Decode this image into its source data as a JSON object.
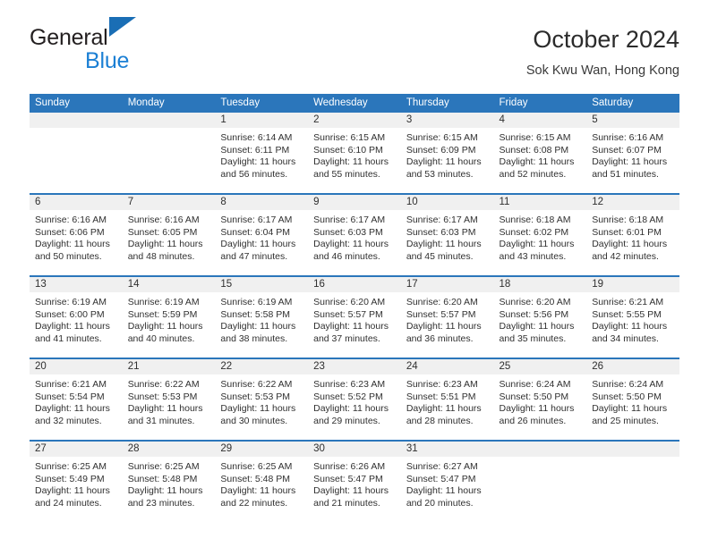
{
  "brand": {
    "name_top": "General",
    "name_bottom": "Blue",
    "triangle_color": "#1a6eb5",
    "blue_color": "#1b7fd4"
  },
  "header": {
    "title": "October 2024",
    "subtitle": "Sok Kwu Wan, Hong Kong"
  },
  "theme": {
    "header_blue": "#2b76bb",
    "daynum_band": "#f0f0f0",
    "text": "#303030"
  },
  "weekdays": [
    "Sunday",
    "Monday",
    "Tuesday",
    "Wednesday",
    "Thursday",
    "Friday",
    "Saturday"
  ],
  "weeks": [
    [
      {
        "day": "",
        "sunrise": "",
        "sunset": "",
        "daylight": "",
        "empty": true
      },
      {
        "day": "",
        "sunrise": "",
        "sunset": "",
        "daylight": "",
        "empty": true
      },
      {
        "day": "1",
        "sunrise": "Sunrise: 6:14 AM",
        "sunset": "Sunset: 6:11 PM",
        "daylight": "Daylight: 11 hours and 56 minutes."
      },
      {
        "day": "2",
        "sunrise": "Sunrise: 6:15 AM",
        "sunset": "Sunset: 6:10 PM",
        "daylight": "Daylight: 11 hours and 55 minutes."
      },
      {
        "day": "3",
        "sunrise": "Sunrise: 6:15 AM",
        "sunset": "Sunset: 6:09 PM",
        "daylight": "Daylight: 11 hours and 53 minutes."
      },
      {
        "day": "4",
        "sunrise": "Sunrise: 6:15 AM",
        "sunset": "Sunset: 6:08 PM",
        "daylight": "Daylight: 11 hours and 52 minutes."
      },
      {
        "day": "5",
        "sunrise": "Sunrise: 6:16 AM",
        "sunset": "Sunset: 6:07 PM",
        "daylight": "Daylight: 11 hours and 51 minutes."
      }
    ],
    [
      {
        "day": "6",
        "sunrise": "Sunrise: 6:16 AM",
        "sunset": "Sunset: 6:06 PM",
        "daylight": "Daylight: 11 hours and 50 minutes."
      },
      {
        "day": "7",
        "sunrise": "Sunrise: 6:16 AM",
        "sunset": "Sunset: 6:05 PM",
        "daylight": "Daylight: 11 hours and 48 minutes."
      },
      {
        "day": "8",
        "sunrise": "Sunrise: 6:17 AM",
        "sunset": "Sunset: 6:04 PM",
        "daylight": "Daylight: 11 hours and 47 minutes."
      },
      {
        "day": "9",
        "sunrise": "Sunrise: 6:17 AM",
        "sunset": "Sunset: 6:03 PM",
        "daylight": "Daylight: 11 hours and 46 minutes."
      },
      {
        "day": "10",
        "sunrise": "Sunrise: 6:17 AM",
        "sunset": "Sunset: 6:03 PM",
        "daylight": "Daylight: 11 hours and 45 minutes."
      },
      {
        "day": "11",
        "sunrise": "Sunrise: 6:18 AM",
        "sunset": "Sunset: 6:02 PM",
        "daylight": "Daylight: 11 hours and 43 minutes."
      },
      {
        "day": "12",
        "sunrise": "Sunrise: 6:18 AM",
        "sunset": "Sunset: 6:01 PM",
        "daylight": "Daylight: 11 hours and 42 minutes."
      }
    ],
    [
      {
        "day": "13",
        "sunrise": "Sunrise: 6:19 AM",
        "sunset": "Sunset: 6:00 PM",
        "daylight": "Daylight: 11 hours and 41 minutes."
      },
      {
        "day": "14",
        "sunrise": "Sunrise: 6:19 AM",
        "sunset": "Sunset: 5:59 PM",
        "daylight": "Daylight: 11 hours and 40 minutes."
      },
      {
        "day": "15",
        "sunrise": "Sunrise: 6:19 AM",
        "sunset": "Sunset: 5:58 PM",
        "daylight": "Daylight: 11 hours and 38 minutes."
      },
      {
        "day": "16",
        "sunrise": "Sunrise: 6:20 AM",
        "sunset": "Sunset: 5:57 PM",
        "daylight": "Daylight: 11 hours and 37 minutes."
      },
      {
        "day": "17",
        "sunrise": "Sunrise: 6:20 AM",
        "sunset": "Sunset: 5:57 PM",
        "daylight": "Daylight: 11 hours and 36 minutes."
      },
      {
        "day": "18",
        "sunrise": "Sunrise: 6:20 AM",
        "sunset": "Sunset: 5:56 PM",
        "daylight": "Daylight: 11 hours and 35 minutes."
      },
      {
        "day": "19",
        "sunrise": "Sunrise: 6:21 AM",
        "sunset": "Sunset: 5:55 PM",
        "daylight": "Daylight: 11 hours and 34 minutes."
      }
    ],
    [
      {
        "day": "20",
        "sunrise": "Sunrise: 6:21 AM",
        "sunset": "Sunset: 5:54 PM",
        "daylight": "Daylight: 11 hours and 32 minutes."
      },
      {
        "day": "21",
        "sunrise": "Sunrise: 6:22 AM",
        "sunset": "Sunset: 5:53 PM",
        "daylight": "Daylight: 11 hours and 31 minutes."
      },
      {
        "day": "22",
        "sunrise": "Sunrise: 6:22 AM",
        "sunset": "Sunset: 5:53 PM",
        "daylight": "Daylight: 11 hours and 30 minutes."
      },
      {
        "day": "23",
        "sunrise": "Sunrise: 6:23 AM",
        "sunset": "Sunset: 5:52 PM",
        "daylight": "Daylight: 11 hours and 29 minutes."
      },
      {
        "day": "24",
        "sunrise": "Sunrise: 6:23 AM",
        "sunset": "Sunset: 5:51 PM",
        "daylight": "Daylight: 11 hours and 28 minutes."
      },
      {
        "day": "25",
        "sunrise": "Sunrise: 6:24 AM",
        "sunset": "Sunset: 5:50 PM",
        "daylight": "Daylight: 11 hours and 26 minutes."
      },
      {
        "day": "26",
        "sunrise": "Sunrise: 6:24 AM",
        "sunset": "Sunset: 5:50 PM",
        "daylight": "Daylight: 11 hours and 25 minutes."
      }
    ],
    [
      {
        "day": "27",
        "sunrise": "Sunrise: 6:25 AM",
        "sunset": "Sunset: 5:49 PM",
        "daylight": "Daylight: 11 hours and 24 minutes."
      },
      {
        "day": "28",
        "sunrise": "Sunrise: 6:25 AM",
        "sunset": "Sunset: 5:48 PM",
        "daylight": "Daylight: 11 hours and 23 minutes."
      },
      {
        "day": "29",
        "sunrise": "Sunrise: 6:25 AM",
        "sunset": "Sunset: 5:48 PM",
        "daylight": "Daylight: 11 hours and 22 minutes."
      },
      {
        "day": "30",
        "sunrise": "Sunrise: 6:26 AM",
        "sunset": "Sunset: 5:47 PM",
        "daylight": "Daylight: 11 hours and 21 minutes."
      },
      {
        "day": "31",
        "sunrise": "Sunrise: 6:27 AM",
        "sunset": "Sunset: 5:47 PM",
        "daylight": "Daylight: 11 hours and 20 minutes."
      },
      {
        "day": "",
        "sunrise": "",
        "sunset": "",
        "daylight": "",
        "empty": true
      },
      {
        "day": "",
        "sunrise": "",
        "sunset": "",
        "daylight": "",
        "empty": true
      }
    ]
  ]
}
